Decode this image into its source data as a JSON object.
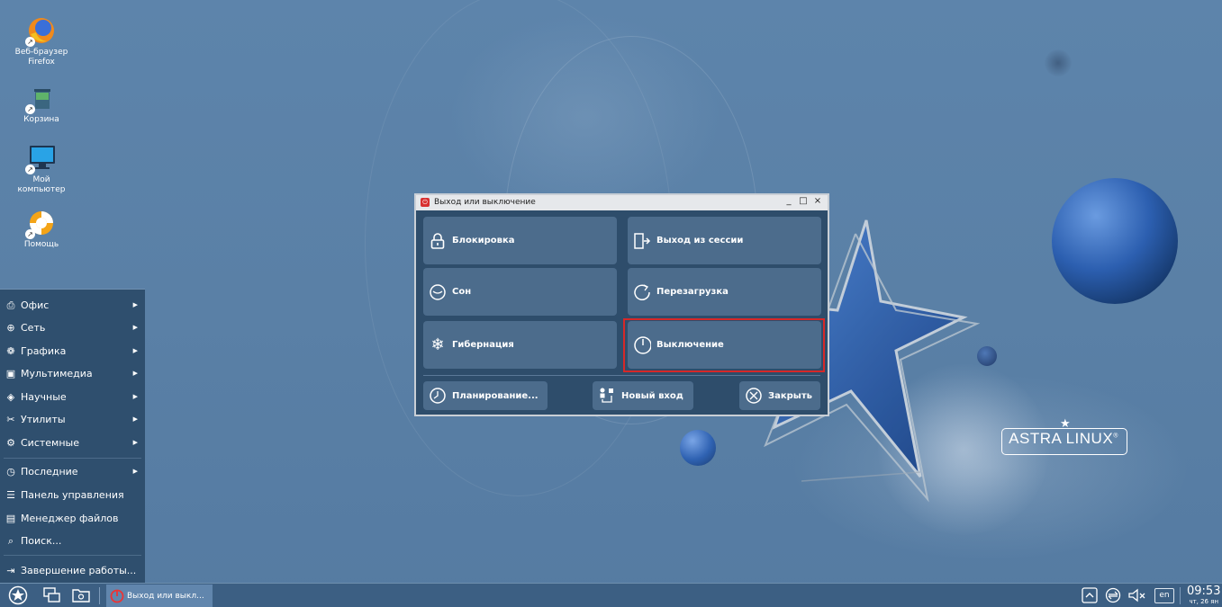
{
  "desktop": {
    "icons": [
      {
        "name": "firefox",
        "label": "Веб-браузер Firefox"
      },
      {
        "name": "trash",
        "label": "Корзина"
      },
      {
        "name": "my-computer",
        "label": "Мой компьютер"
      },
      {
        "name": "help",
        "label": "Помощь"
      }
    ],
    "logo_text": "ASTRA LINUX",
    "logo_mark": "®"
  },
  "start_menu": {
    "items": [
      {
        "label": "Офис",
        "icon": "printer-icon",
        "submenu": true
      },
      {
        "label": "Сеть",
        "icon": "globe-icon",
        "submenu": true
      },
      {
        "label": "Графика",
        "icon": "palette-icon",
        "submenu": true
      },
      {
        "label": "Мультимедиа",
        "icon": "play-icon",
        "submenu": true
      },
      {
        "label": "Научные",
        "icon": "atom-icon",
        "submenu": true
      },
      {
        "label": "Утилиты",
        "icon": "tools-icon",
        "submenu": true
      },
      {
        "label": "Системные",
        "icon": "gear-icon",
        "submenu": true
      },
      {
        "label": "Последние",
        "icon": "history-icon",
        "submenu": true
      },
      {
        "label": "Панель управления",
        "icon": "sliders-icon",
        "submenu": false
      },
      {
        "label": "Менеджер файлов",
        "icon": "folder-icon",
        "submenu": false
      },
      {
        "label": "Поиск...",
        "icon": "search-icon",
        "submenu": false
      },
      {
        "label": "Завершение работы...",
        "icon": "logout-icon",
        "submenu": false
      }
    ]
  },
  "dialog": {
    "title": "Выход или выключение",
    "controls": {
      "minimize": "_",
      "maximize": "□",
      "close": "×"
    },
    "buttons": {
      "lock": "Блокировка",
      "logout": "Выход из сессии",
      "sleep": "Сон",
      "reboot": "Перезагрузка",
      "hibernate": "Гибернация",
      "shutdown": "Выключение",
      "schedule": "Планирование...",
      "new_login": "Новый вход",
      "close": "Закрыть"
    },
    "highlighted_button": "shutdown",
    "highlight_color": "#d62828"
  },
  "taskbar": {
    "task_label": "Выход или выкл...",
    "lang": "en",
    "time": "09:53",
    "date": "чт, 26 ян"
  },
  "colors": {
    "desktop_bg": "#5a80a6",
    "dialog_bg": "#2e4d6b",
    "button_bg": "#4c6c8c",
    "taskbar_bg": "#3c5f83"
  }
}
